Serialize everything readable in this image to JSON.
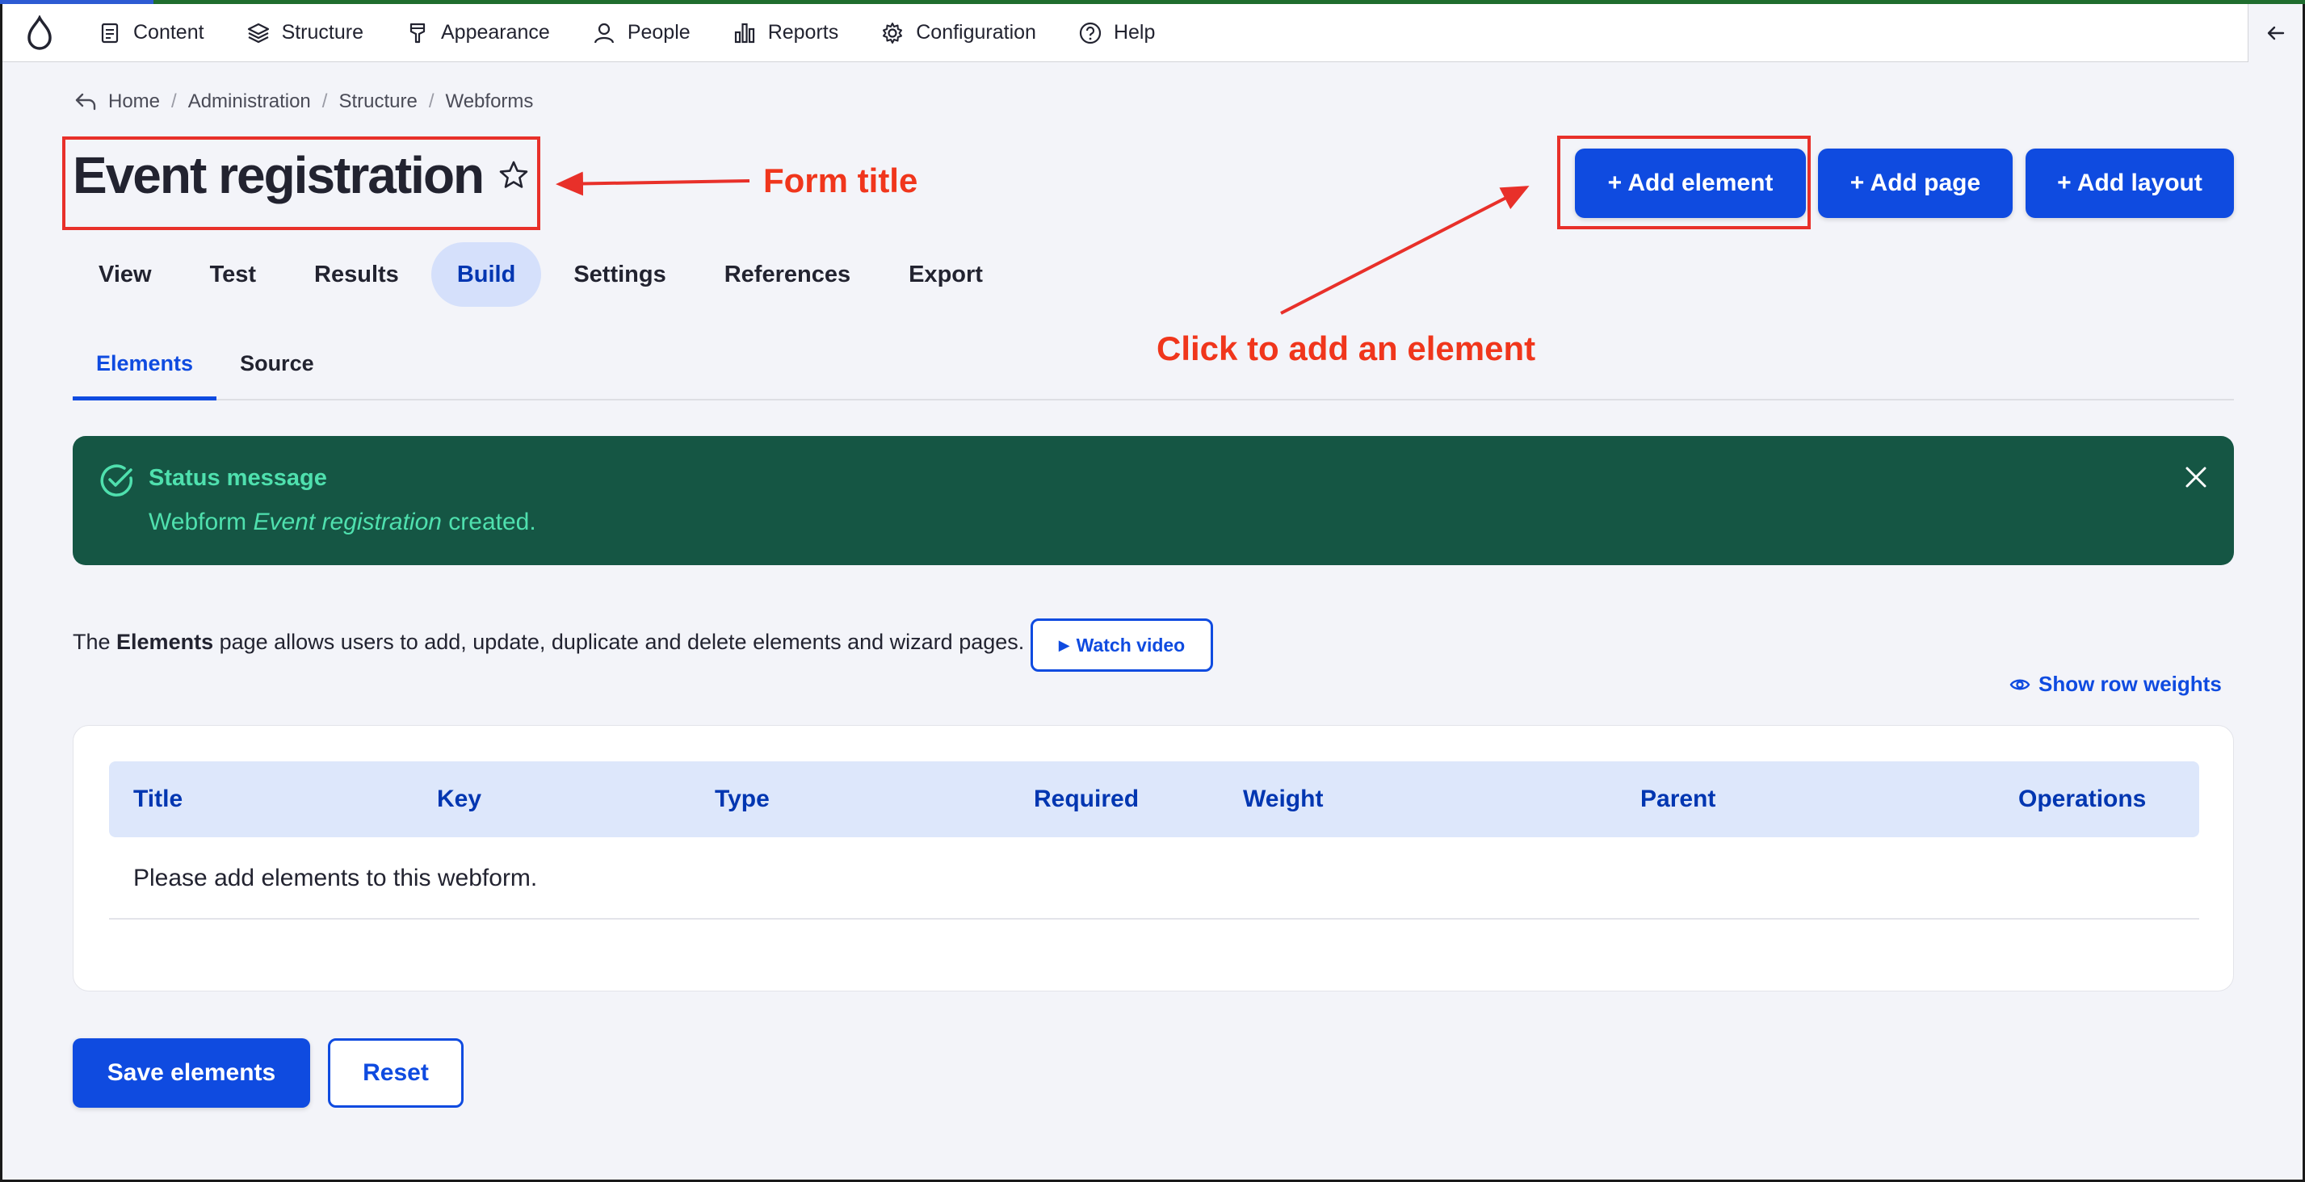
{
  "toolbar": {
    "items": [
      {
        "label": "Content",
        "icon": "content-icon"
      },
      {
        "label": "Structure",
        "icon": "structure-icon"
      },
      {
        "label": "Appearance",
        "icon": "appearance-icon"
      },
      {
        "label": "People",
        "icon": "people-icon"
      },
      {
        "label": "Reports",
        "icon": "reports-icon"
      },
      {
        "label": "Configuration",
        "icon": "gear-icon"
      },
      {
        "label": "Help",
        "icon": "help-icon"
      }
    ]
  },
  "breadcrumb": [
    "Home",
    "Administration",
    "Structure",
    "Webforms"
  ],
  "page": {
    "title": "Event registration"
  },
  "annotations": {
    "form_title": "Form title",
    "add_element": "Click to add an element",
    "color": "#f0361c"
  },
  "actions": {
    "add_element": "+ Add element",
    "add_page": "+ Add page",
    "add_layout": "+ Add layout"
  },
  "primary_tabs": [
    "View",
    "Test",
    "Results",
    "Build",
    "Settings",
    "References",
    "Export"
  ],
  "primary_tab_active": "Build",
  "secondary_tabs": [
    "Elements",
    "Source"
  ],
  "status": {
    "title": "Status message",
    "body_prefix": "Webform ",
    "body_em": "Event registration",
    "body_suffix": " created.",
    "bg_color": "#155644",
    "text_color": "#4fe0ae"
  },
  "description": {
    "prefix": "The ",
    "bold": "Elements",
    "suffix": " page allows users to add, update, duplicate and delete elements and wizard pages.",
    "video_button": "Watch video"
  },
  "row_weights_link": "Show row weights",
  "table": {
    "columns": [
      "Title",
      "Key",
      "Type",
      "Required",
      "Weight",
      "Parent",
      "Operations"
    ],
    "empty_message": "Please add elements to this webform."
  },
  "footer": {
    "save": "Save elements",
    "reset": "Reset"
  },
  "colors": {
    "accent": "#0f4be0",
    "accent_dark": "#0036b1"
  }
}
